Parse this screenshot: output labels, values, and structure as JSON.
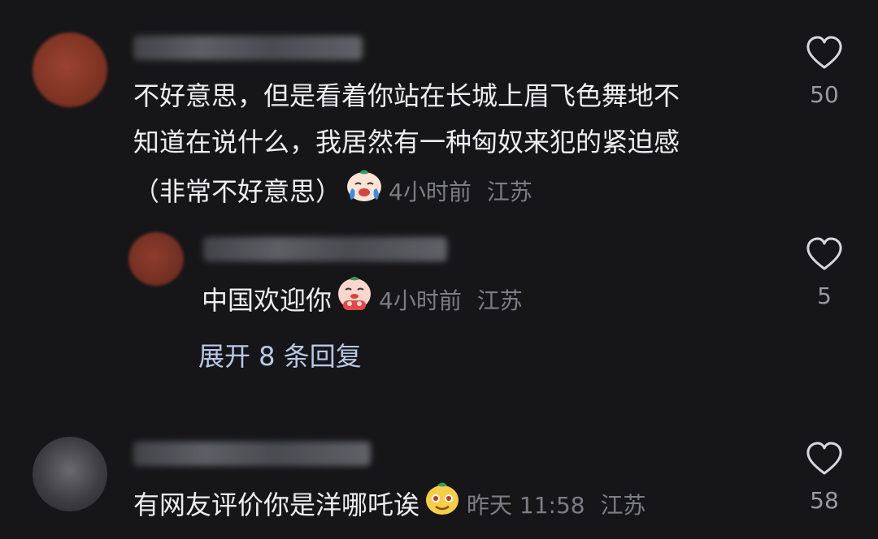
{
  "comments": [
    {
      "text_lines": [
        "不好意思，但是看着你站在长城上眉飞色舞地不",
        "知道在说什么，我居然有一种匈奴来犯的紧迫感",
        "（非常不好意思）"
      ],
      "time": "4小时前",
      "location": "江苏",
      "emoji": "crying-face-emoji",
      "like_count": "50",
      "avatar_color": "#8a3b25"
    },
    {
      "text": "中国欢迎你",
      "time": "4小时前",
      "location": "江苏",
      "emoji": "bowing-face-emoji",
      "like_count": "5",
      "avatar_color": "#7a3325"
    },
    {
      "text": "有网友评价你是洋哪吒诶",
      "time": "昨天 11:58",
      "location": "江苏",
      "emoji": "yellow-face-emoji",
      "like_count": "58",
      "avatar_color": "#3a3a3d"
    }
  ],
  "expand_replies": "展开 8 条回复",
  "accent": "#b8c8e6"
}
